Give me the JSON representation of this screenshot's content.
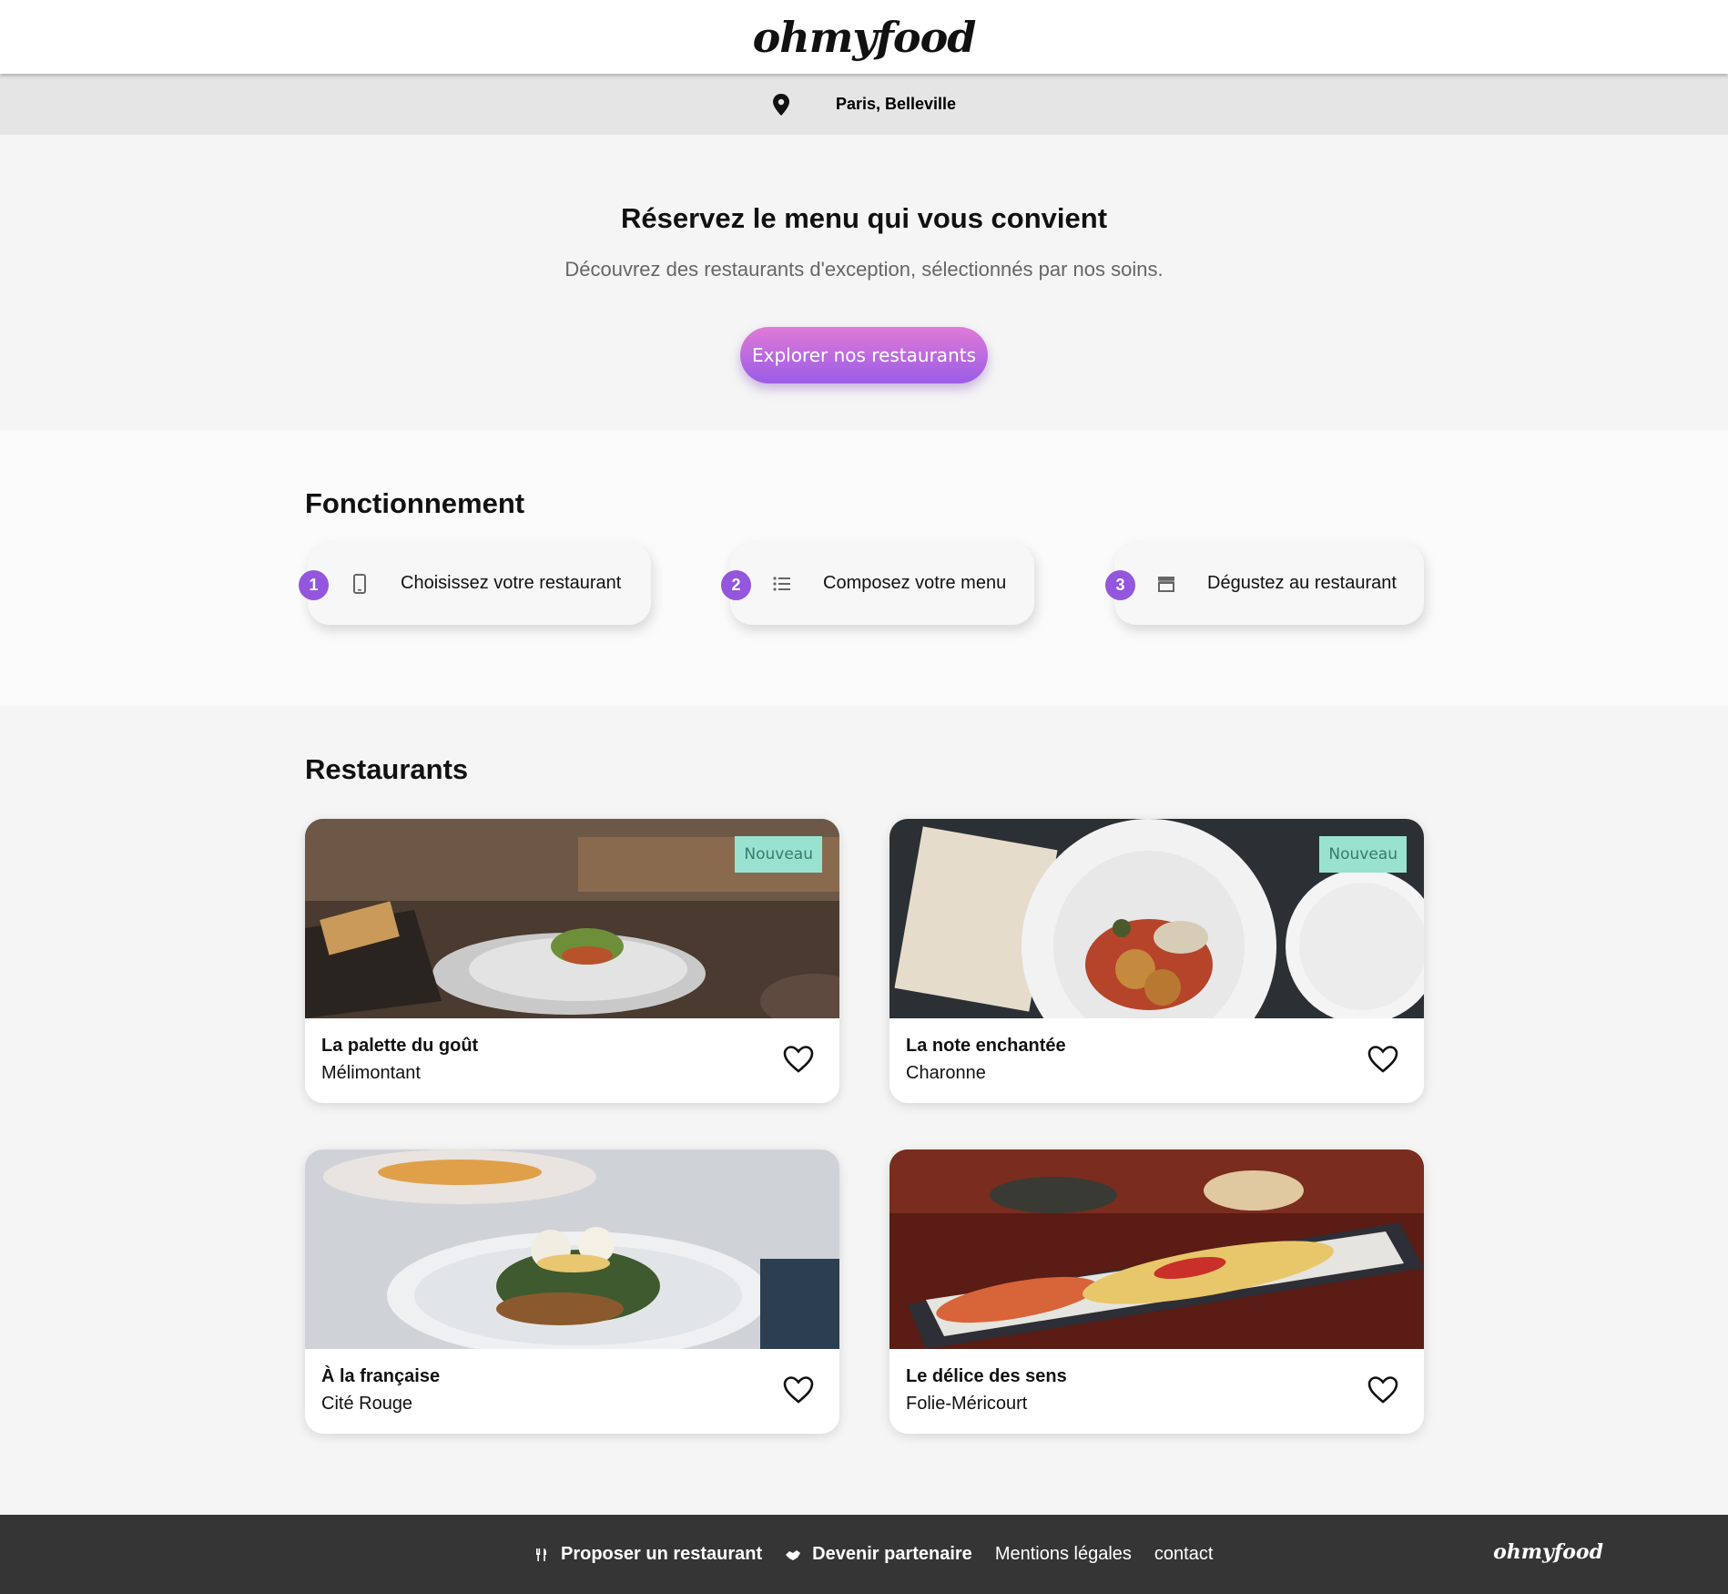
{
  "header": {
    "logo": "ohmyfood"
  },
  "location": {
    "icon": "map-pin-icon",
    "text": "Paris, Belleville"
  },
  "hero": {
    "title": "Réservez le menu qui vous convient",
    "subtitle": "Découvrez des restaurants d'exception, sélectionnés par nos soins.",
    "cta_label": "Explorer nos restaurants"
  },
  "how": {
    "title": "Fonctionnement",
    "steps": [
      {
        "number": "1",
        "icon": "mobile-phone-icon",
        "label": "Choisissez votre restaurant"
      },
      {
        "number": "2",
        "icon": "list-icon",
        "label": "Composez votre menu"
      },
      {
        "number": "3",
        "icon": "store-icon",
        "label": "Dégustez au restaurant"
      }
    ]
  },
  "restaurants": {
    "title": "Restaurants",
    "badge_label": "Nouveau",
    "items": [
      {
        "name": "La palette du goût",
        "area": "Mélimontant",
        "is_new": true
      },
      {
        "name": "La note enchantée",
        "area": "Charonne",
        "is_new": true
      },
      {
        "name": "À la française",
        "area": "Cité Rouge",
        "is_new": false
      },
      {
        "name": "Le délice des sens",
        "area": "Folie-Méricourt",
        "is_new": false
      }
    ]
  },
  "footer": {
    "links": [
      {
        "label": "Proposer un restaurant",
        "icon": "utensils-icon",
        "bold": true
      },
      {
        "label": "Devenir partenaire",
        "icon": "handshake-icon",
        "bold": true
      },
      {
        "label": "Mentions légales",
        "icon": "",
        "bold": false
      },
      {
        "label": "contact",
        "icon": "",
        "bold": false
      }
    ],
    "logo": "ohmyfood"
  },
  "colors": {
    "accent_purple": "#9356dc",
    "badge_green": "#99e2d0",
    "footer_bg": "#353535"
  }
}
